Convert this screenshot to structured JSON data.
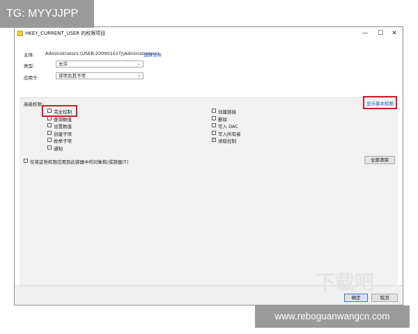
{
  "overlay": {
    "tag": "TG: MYYJJPP",
    "url": "www.reboguanwangcn.com",
    "watermark": "下载吧"
  },
  "window": {
    "title": "HKEY_CURRENT_USER 的权限项目",
    "min": "—",
    "max": "☐",
    "close": "✕"
  },
  "principal": {
    "label": "主体:",
    "value": "Administrators (USER-20090101TJ\\Administrators)",
    "link": "选择主体"
  },
  "type": {
    "label": "类型:",
    "value": "允许"
  },
  "applies": {
    "label": "应用于:",
    "value": "该项及其子项"
  },
  "advanced": {
    "label": "高级权限:",
    "show_basic": "显示基本权限"
  },
  "perms_left": [
    {
      "label": "完全控制",
      "checked": false
    },
    {
      "label": "查询数值",
      "checked": false
    },
    {
      "label": "设置数值",
      "checked": false
    },
    {
      "label": "创建子项",
      "checked": false
    },
    {
      "label": "枚举子项",
      "checked": false
    },
    {
      "label": "通知",
      "checked": false
    }
  ],
  "perms_right": [
    {
      "label": "创建链接",
      "checked": false
    },
    {
      "label": "删除",
      "checked": false
    },
    {
      "label": "写入 DAC",
      "checked": false
    },
    {
      "label": "写入所有者",
      "checked": false
    },
    {
      "label": "读取控制",
      "checked": true
    }
  ],
  "apply_only": {
    "label": "仅将这些权限应用到此容器中的对象和/或容器(T)",
    "checked": false
  },
  "clear_all": "全部清除",
  "ok": "确定",
  "cancel": "取消",
  "colors": {
    "highlight": "#c8202a",
    "link": "#1a5ec8"
  }
}
